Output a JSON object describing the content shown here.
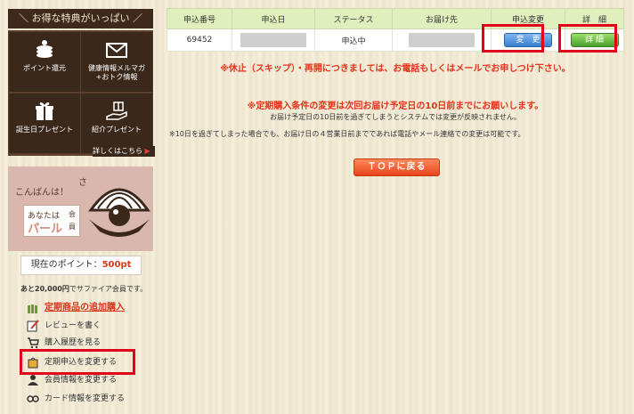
{
  "sidebar": {
    "benefits_header": "＼ お得な特典がいっぱい ／",
    "benefits": [
      {
        "label": "ポイント還元",
        "icon": "coins-icon"
      },
      {
        "label": "健康情報メルマガ\n+おトク情報",
        "icon": "mail-icon"
      },
      {
        "label": "誕生日プレゼント",
        "icon": "gift-icon"
      },
      {
        "label": "紹介プレゼント",
        "icon": "hand-gift-icon"
      }
    ],
    "benefits_more": "詳しくはこちら",
    "greeting": "こんばんは！",
    "greeting_suffix": "さ",
    "rank_prefix": "あなたは",
    "rank_name": "パール",
    "rank_kai": "会",
    "rank_in": "員",
    "points_label": "現在のポイント：",
    "points_value": "500pt",
    "upgrade_amount": "あと20,000円",
    "upgrade_rest": "でサファイア会員です。",
    "menu": [
      {
        "label": "定期商品の追加購入",
        "icon": "bottles-icon"
      },
      {
        "label": "レビューを書く",
        "icon": "pencil-icon"
      },
      {
        "label": "購入履歴を見る",
        "icon": "cart-icon"
      },
      {
        "label": "定期申込を変更する",
        "icon": "bag-icon"
      },
      {
        "label": "会員情報を変更する",
        "icon": "person-icon"
      },
      {
        "label": "カード情報を変更する",
        "icon": "card-icon"
      }
    ]
  },
  "table": {
    "headers": [
      "申込番号",
      "申込日",
      "ステータス",
      "お届け先",
      "申込変更",
      "詳　細"
    ],
    "row": {
      "order_no": "69452",
      "status": "申込中",
      "change_button": "変　更",
      "detail_button": "詳 細"
    }
  },
  "notices": {
    "skip": "※休止（スキップ）・再開につきましては、お電話もしくはメールでお申しつけ下さい。",
    "change_deadline": "※定期購入条件の変更は次回お届け予定日の10日前までにお願いします。",
    "system": "お届け予定日の10日前を過ぎてしまうとシステムでは変更が反映されません。",
    "phone": "※10日を過ぎてしまった場合でも、お届け日の４営業日前までであれば電話やメール連絡での変更は可能です。"
  },
  "top_button": "ＴＯＰに戻る",
  "colors": {
    "highlight": "#e3001b",
    "accent_red": "#e8321c",
    "header_green": "#dff0bd"
  }
}
